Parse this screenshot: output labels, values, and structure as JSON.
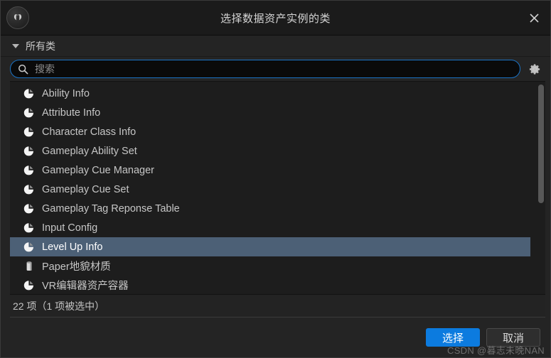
{
  "window": {
    "title": "选择数据资产实例的类",
    "logo_icon": "unreal-engine-logo",
    "close_icon": "close-icon"
  },
  "section": {
    "expand_icon": "chevron-down-icon",
    "label": "所有类"
  },
  "search": {
    "icon": "search-icon",
    "value": "",
    "placeholder": "搜索",
    "settings_icon": "gear-icon"
  },
  "list": {
    "items": [
      {
        "label": "Ability Info",
        "icon": "data-asset-icon",
        "selected": false
      },
      {
        "label": "Attribute Info",
        "icon": "data-asset-icon",
        "selected": false
      },
      {
        "label": "Character Class Info",
        "icon": "data-asset-icon",
        "selected": false
      },
      {
        "label": "Gameplay Ability Set",
        "icon": "data-asset-icon",
        "selected": false
      },
      {
        "label": "Gameplay Cue Manager",
        "icon": "data-asset-icon",
        "selected": false
      },
      {
        "label": "Gameplay Cue Set",
        "icon": "data-asset-icon",
        "selected": false
      },
      {
        "label": "Gameplay Tag Reponse Table",
        "icon": "data-asset-icon",
        "selected": false
      },
      {
        "label": "Input Config",
        "icon": "data-asset-icon",
        "selected": false
      },
      {
        "label": "Level Up Info",
        "icon": "data-asset-icon",
        "selected": true
      },
      {
        "label": "Paper地貌材质",
        "icon": "paper-terrain-material-icon",
        "selected": false
      },
      {
        "label": "VR编辑器资产容器",
        "icon": "data-asset-icon",
        "selected": false
      }
    ],
    "scrollbar": "vertical-scrollbar"
  },
  "status": {
    "text": "22 项（1 项被选中）"
  },
  "footer": {
    "select_label": "选择",
    "cancel_label": "取消"
  },
  "watermark": {
    "text": "CSDN @暮志未晚NAN"
  },
  "colors": {
    "accent_blue": "#0c7bdf",
    "selection_blue": "#4c6076",
    "search_focus_border": "#1a72c4",
    "window_bg": "#242424",
    "list_bg": "#1d1d1d",
    "titlebar_bg": "#1b1b1b"
  }
}
